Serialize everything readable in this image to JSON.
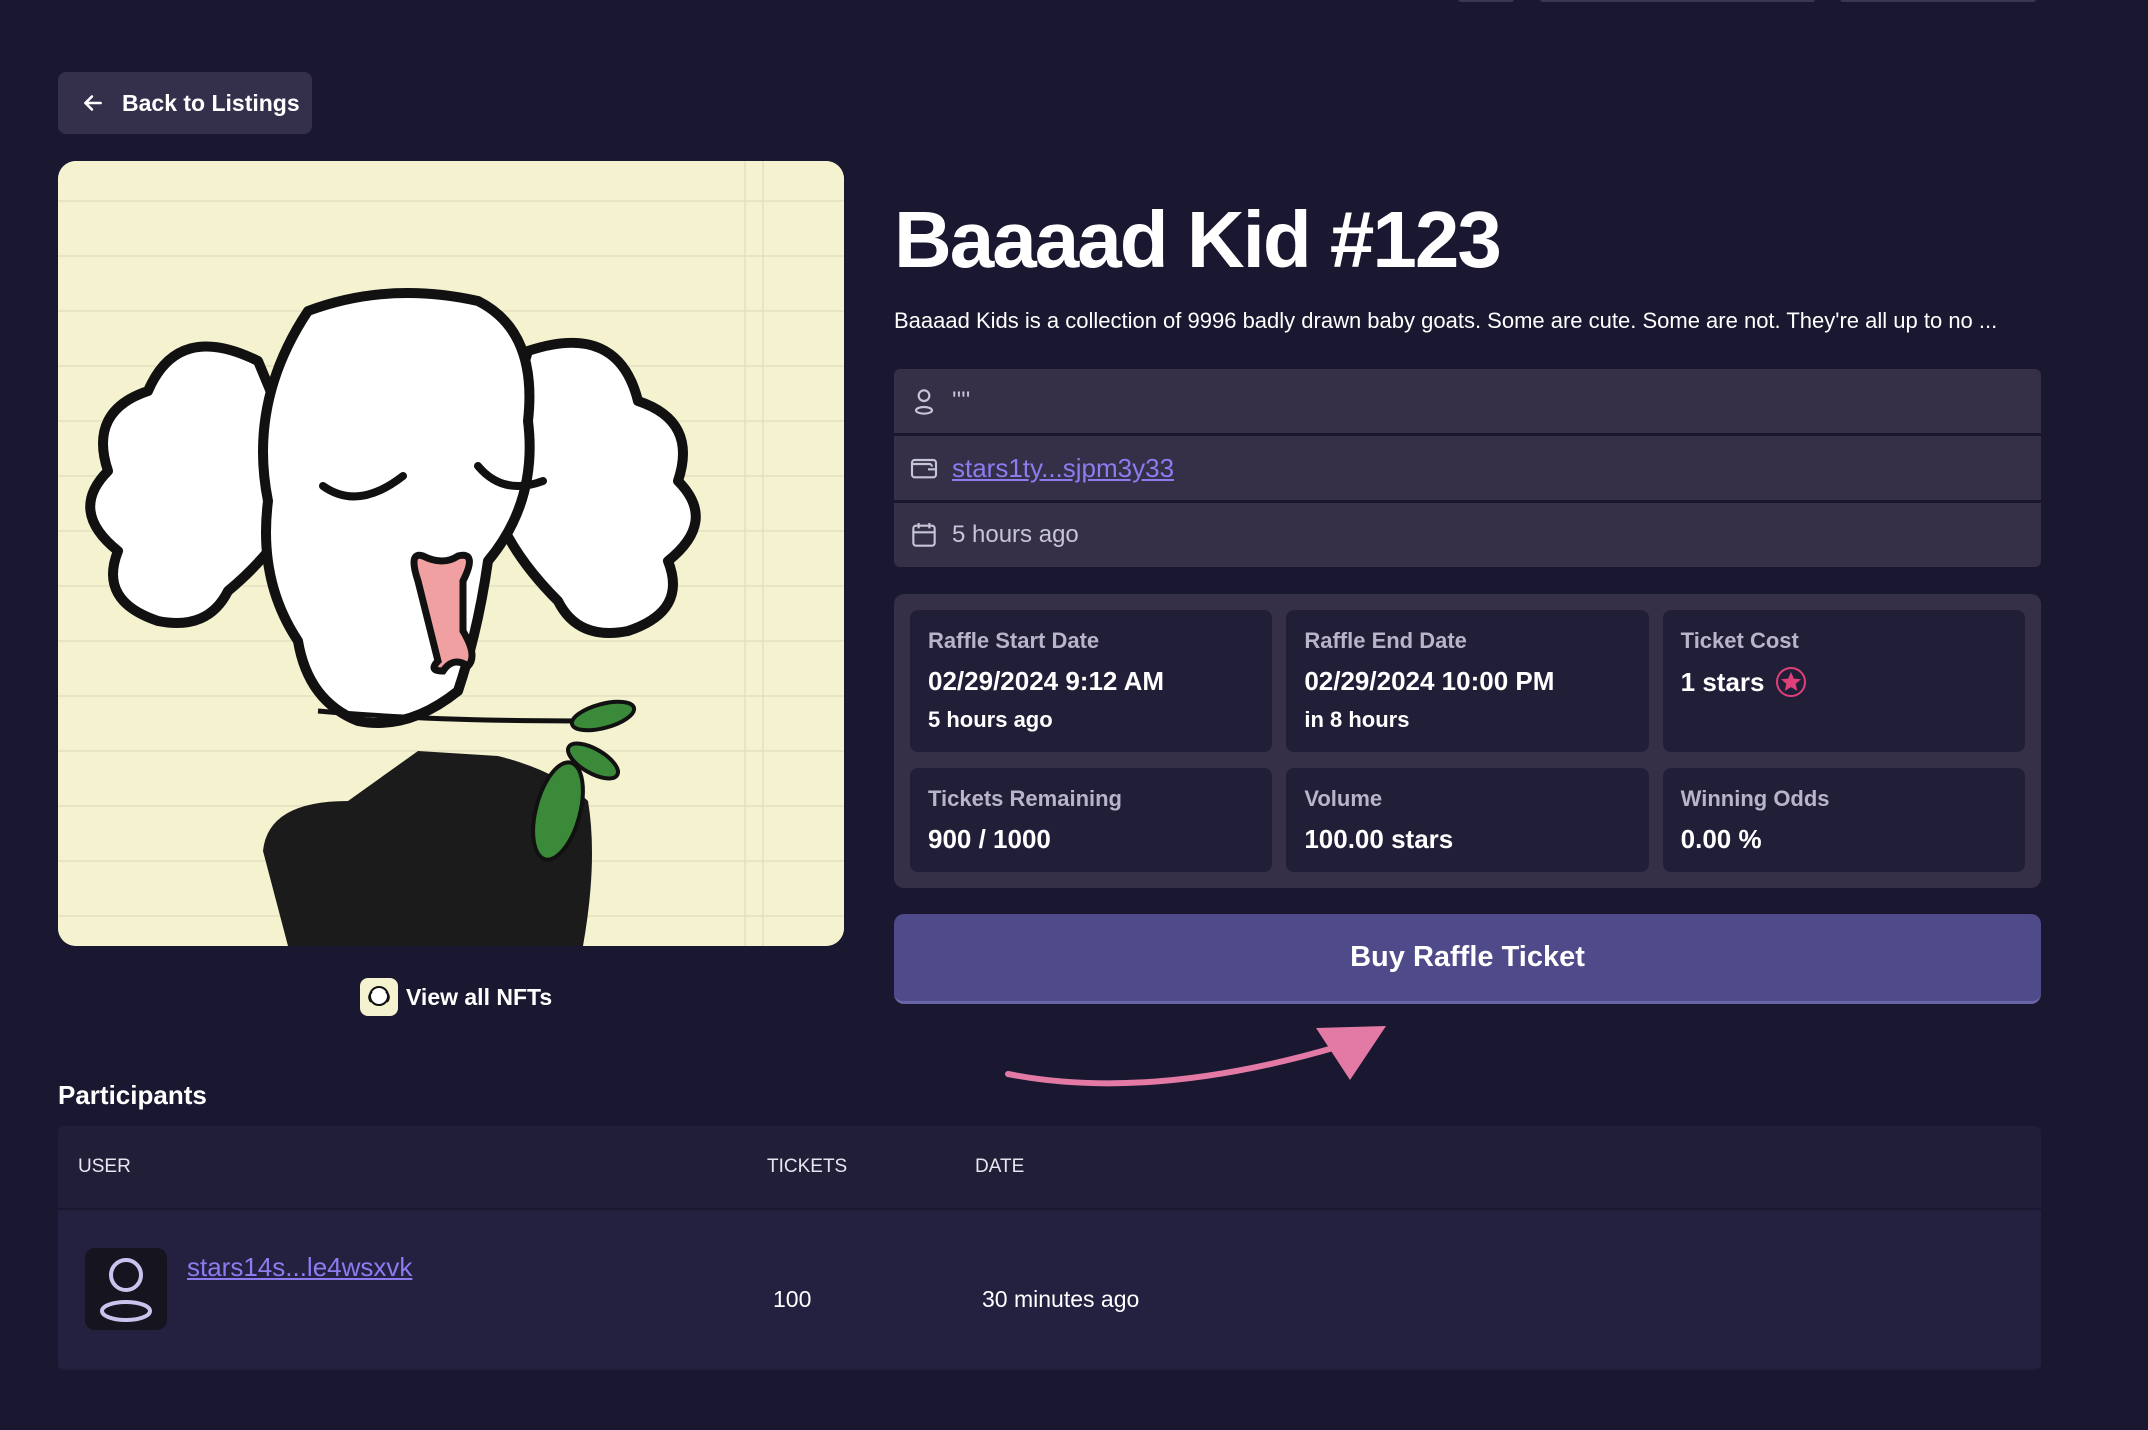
{
  "back_button": {
    "label": "Back to Listings"
  },
  "nft": {
    "title": "Baaaad Kid #123",
    "description": "Baaaad Kids is a collection of 9996 badly drawn baby goats. Some are cute. Some are not. They're all up to no ...",
    "view_all_label": "View all NFTs"
  },
  "info": {
    "owner_name": "''''",
    "wallet": "stars1ty...sjpm3y33",
    "listed": "5 hours ago"
  },
  "stats": {
    "start": {
      "label": "Raffle Start Date",
      "value": "02/29/2024 9:12 AM",
      "sub": "5 hours ago"
    },
    "end": {
      "label": "Raffle End Date",
      "value": "02/29/2024 10:00 PM",
      "sub": "in 8 hours"
    },
    "cost": {
      "label": "Ticket Cost",
      "value": "1 stars",
      "icon": "stars-token-icon"
    },
    "remaining": {
      "label": "Tickets Remaining",
      "value": "900 / 1000"
    },
    "volume": {
      "label": "Volume",
      "value": "100.00 stars"
    },
    "odds": {
      "label": "Winning Odds",
      "value": "0.00 %"
    }
  },
  "buy_button": {
    "label": "Buy Raffle Ticket"
  },
  "participants": {
    "title": "Participants",
    "columns": [
      "USER",
      "TICKETS",
      "DATE"
    ],
    "rows": [
      {
        "user": "stars14s...le4wsxvk",
        "tickets": "100",
        "date": "30 minutes ago"
      }
    ]
  },
  "colors": {
    "background": "#1a1830",
    "panel": "#352f48",
    "card": "#211e38",
    "accent": "#4f4a89",
    "link": "#8b7cf0",
    "arrow": "#e27aa5",
    "star": "#e0407a"
  }
}
